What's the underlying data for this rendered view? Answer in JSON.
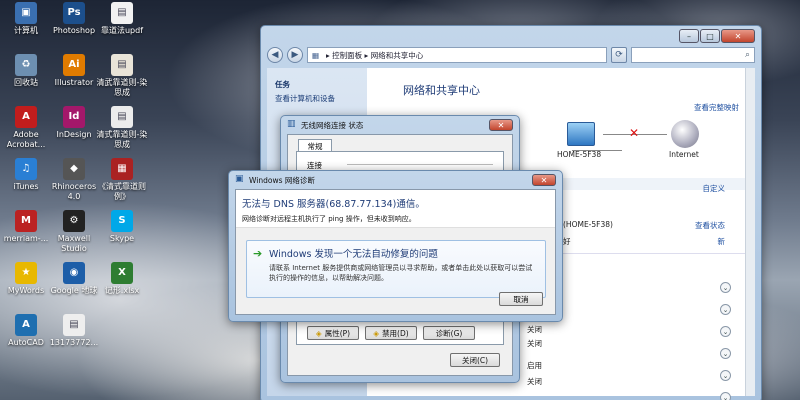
{
  "desktop": {
    "icons": [
      {
        "label": "计算机",
        "color": "#3a6fb0",
        "glyph": "▣"
      },
      {
        "label": "Photoshop",
        "color": "#1c4f8c",
        "glyph": "Ps"
      },
      {
        "label": "靠道法updf",
        "color": "#f2f2f2",
        "glyph": "▤"
      },
      {
        "label": "回收站",
        "color": "#6d8fb1",
        "glyph": "♻"
      },
      {
        "label": "Illustrator",
        "color": "#e07b00",
        "glyph": "Ai"
      },
      {
        "label": "清武靠道则-染思成",
        "color": "#e9e4d8",
        "glyph": "▤"
      },
      {
        "label": "Adobe Acrobat...",
        "color": "#c21d1d",
        "glyph": "A"
      },
      {
        "label": "InDesign",
        "color": "#a4186a",
        "glyph": "Id"
      },
      {
        "label": "清式靠道则-染思成",
        "color": "#ececec",
        "glyph": "▤"
      },
      {
        "label": "iTunes",
        "color": "#2a7fd4",
        "glyph": "♫"
      },
      {
        "label": "Rhinoceros 4.0",
        "color": "#555",
        "glyph": "◆"
      },
      {
        "label": "《清式靠道则例》",
        "color": "#a22",
        "glyph": "▦"
      },
      {
        "label": "merriam-...",
        "color": "#b22",
        "glyph": "M"
      },
      {
        "label": "Maxwell Studio",
        "color": "#222",
        "glyph": "⚙"
      },
      {
        "label": "Skype",
        "color": "#00a8e8",
        "glyph": "S"
      },
      {
        "label": "MyWords",
        "color": "#e8b800",
        "glyph": "★"
      },
      {
        "label": "Google 地球",
        "color": "#1d5ea8",
        "glyph": "◉"
      },
      {
        "label": "记形.xlsx",
        "color": "#2e7d32",
        "glyph": "X"
      },
      {
        "label": "AutoCAD",
        "color": "#1f6fb0",
        "glyph": "A"
      },
      {
        "label": "13173772...",
        "color": "#eee",
        "glyph": "▤"
      }
    ]
  },
  "control_panel": {
    "breadcrumb": [
      "控制面板",
      "网络和共享中心"
    ],
    "left_links": [
      "任务",
      "查看计算机和设备"
    ],
    "title": "网络和共享中心",
    "view_full_map": "查看完整映射",
    "network_name": "HOME-5F38",
    "internet_label": "Internet",
    "customize": "自定义",
    "network_detail": "(HOME-5F38)",
    "view_status": "查看状态",
    "status_fragment": "好",
    "refresh": "新",
    "toggles": [
      "关闭",
      "关闭",
      "启用",
      "关闭"
    ]
  },
  "wireless_status": {
    "title": "无线网络连接 状态",
    "tab": "常规",
    "connection_label": "连接",
    "buttons": [
      "属性(P)",
      "禁用(D)",
      "诊断(G)"
    ],
    "close": "关闭(C)"
  },
  "diagnostics": {
    "title": "Windows 网络诊断",
    "heading": "无法与 DNS 服务器(68.87.77.134)通信。",
    "subtext": "网络诊断对远程主机执行了 ping 操作，但未收到响应。",
    "fix_title": "Windows 发现一个无法自动修复的问题",
    "fix_desc": "请联系 Internet 服务提供商或网络管理员以寻求帮助，或者单击此处以获取可以尝试执行的操作的信息，以帮助解决问题。",
    "cancel": "取消"
  },
  "colors": {
    "accent": "#1e4fa0",
    "fix_arrow": "#2a9a2a",
    "error_x": "#d11"
  }
}
